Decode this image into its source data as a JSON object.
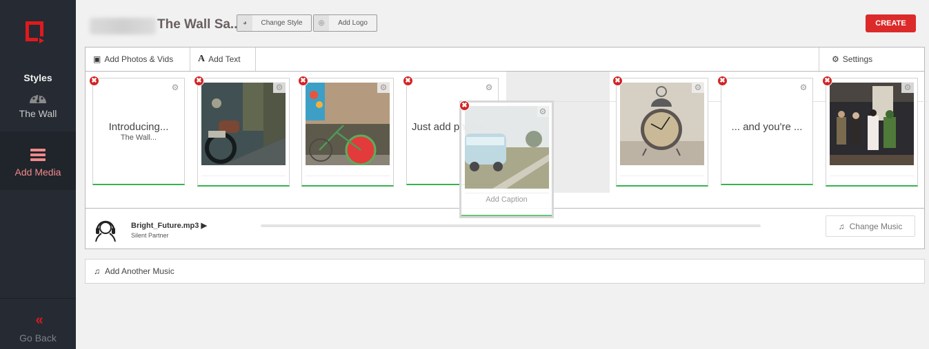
{
  "sidebar": {
    "styles_title": "Styles",
    "style_name": "The Wall",
    "add_media": "Add Media",
    "go_back": "Go Back",
    "back_glyph": "«"
  },
  "header": {
    "project_title": "The Wall Sa...",
    "change_style": "Change Style",
    "add_logo": "Add Logo",
    "create": "CREATE"
  },
  "toolbar": {
    "add_photos": "Add Photos & Vids",
    "add_text": "Add Text",
    "add_text_glyph": "A",
    "settings": "Settings"
  },
  "slides": [
    {
      "type": "text",
      "title": "Introducing...",
      "subtitle": "The Wall..."
    },
    {
      "type": "photo",
      "subject": "motorcycle",
      "colors": [
        "#3b4a4e",
        "#8a5a3c",
        "#1e2628"
      ]
    },
    {
      "type": "photo",
      "subject": "bicycle-watermelon",
      "colors": [
        "#b49a7e",
        "#e33b3b",
        "#6b6b5a"
      ]
    },
    {
      "type": "text",
      "title": "Just add photos...",
      "subtitle": ""
    },
    {
      "type": "photo",
      "subject": "alarm-clock",
      "colors": [
        "#d9d2c6",
        "#6b5e4f",
        "#b8ab94"
      ]
    },
    {
      "type": "text",
      "title": "... and you're ...",
      "subtitle": ""
    },
    {
      "type": "photo",
      "subject": "bus-stop-characters",
      "colors": [
        "#2b2b30",
        "#7a6a5a",
        "#3f5a3a"
      ]
    }
  ],
  "dragging": {
    "subject": "vw-van",
    "caption_placeholder": "Add Caption",
    "colors": [
      "#dfe4e4",
      "#a8c6d0",
      "#7a7a5a"
    ]
  },
  "music": {
    "track": "Bright_Future.mp3",
    "play_glyph": "▶",
    "artist": "Silent Partner",
    "progress": 0,
    "change_label": "Change Music",
    "add_another": "Add Another Music"
  },
  "icons": {
    "remove": "✖",
    "gear": "⚙",
    "note": "♫",
    "style": "◕",
    "logo": "◎",
    "camera": "▣"
  },
  "colors": {
    "accent_red": "#dc2a2a",
    "sidebar_bg": "#262b33",
    "active_pink": "#f08a8a",
    "card_green": "#37b24d"
  }
}
